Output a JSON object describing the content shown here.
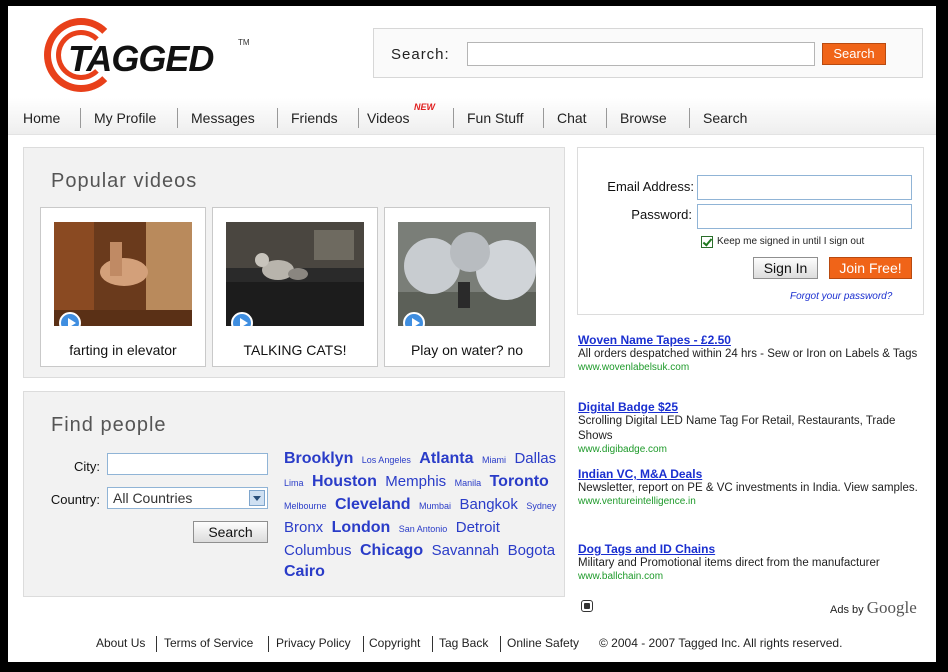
{
  "header": {
    "logo_text": "TAGGED",
    "logo_tm": "TM",
    "search_label": "Search:",
    "search_placeholder": "",
    "search_button": "Search"
  },
  "nav": {
    "items": [
      "Home",
      "My Profile",
      "Messages",
      "Friends",
      "Videos",
      "Fun Stuff",
      "Chat",
      "Browse",
      "Search"
    ],
    "videos_badge": "NEW"
  },
  "popular_videos": {
    "title": "Popular videos",
    "videos": [
      {
        "caption": "farting in elevator"
      },
      {
        "caption": "TALKING CATS!"
      },
      {
        "caption": "Play on water? no"
      }
    ]
  },
  "find_people": {
    "title": "Find people",
    "city_label": "City:",
    "city_value": "",
    "country_label": "Country:",
    "country_value": "All Countries",
    "search_button": "Search",
    "cities": [
      {
        "name": "Brooklyn",
        "size": "l"
      },
      {
        "name": "Los Angeles",
        "size": "s"
      },
      {
        "name": "Atlanta",
        "size": "l"
      },
      {
        "name": "Miami",
        "size": "s"
      },
      {
        "name": "Dallas",
        "size": "m"
      },
      {
        "name": "Lima",
        "size": "s"
      },
      {
        "name": "Houston",
        "size": "l"
      },
      {
        "name": "Memphis",
        "size": "m"
      },
      {
        "name": "Manila",
        "size": "s"
      },
      {
        "name": "Toronto",
        "size": "l"
      },
      {
        "name": "Melbourne",
        "size": "s"
      },
      {
        "name": "Cleveland",
        "size": "l"
      },
      {
        "name": "Mumbai",
        "size": "s"
      },
      {
        "name": "Bangkok",
        "size": "m"
      },
      {
        "name": "Sydney",
        "size": "s"
      },
      {
        "name": "Bronx",
        "size": "m"
      },
      {
        "name": "London",
        "size": "l"
      },
      {
        "name": "San Antonio",
        "size": "s"
      },
      {
        "name": "Detroit",
        "size": "m"
      },
      {
        "name": "Columbus",
        "size": "m"
      },
      {
        "name": "Chicago",
        "size": "l"
      },
      {
        "name": "Savannah",
        "size": "m"
      },
      {
        "name": "Bogota",
        "size": "m"
      },
      {
        "name": "Cairo",
        "size": "l"
      }
    ]
  },
  "login": {
    "email_label": "Email Address:",
    "email_value": "",
    "password_label": "Password:",
    "password_value": "",
    "keep_signed_in": "Keep me signed in until I sign out",
    "sign_in_button": "Sign In",
    "join_button": "Join Free!",
    "forgot_link": "Forgot your password?"
  },
  "ads": {
    "items": [
      {
        "title": "Woven Name Tapes - £2.50",
        "desc": "All orders despatched within 24 hrs - Sew or Iron on Labels & Tags",
        "url": "www.wovenlabelsuk.com"
      },
      {
        "title": "Digital Badge $25",
        "desc": "Scrolling Digital LED Name Tag For Retail, Restaurants, Trade Shows",
        "url": "www.digibadge.com"
      },
      {
        "title": "Indian VC, M&A Deals",
        "desc": "Newsletter, report on PE & VC investments in India. View samples.",
        "url": "www.ventureintelligence.in"
      },
      {
        "title": "Dog Tags and ID Chains",
        "desc": "Military and Promotional items direct from the manufacturer",
        "url": "www.ballchain.com"
      }
    ],
    "ads_by": "Ads by",
    "google": "Google"
  },
  "footer": {
    "links": [
      "About Us",
      "Terms of Service",
      "Privacy Policy",
      "Copyright",
      "Tag Back",
      "Online Safety"
    ],
    "copyright": "© 2004 - 2007 Tagged Inc. All rights reserved."
  },
  "colors": {
    "accent_orange": "#f06418",
    "link_blue": "#1a2fd0",
    "city_blue": "#2a3cc8",
    "url_green": "#1e9a2a",
    "logo_red": "#e8401a"
  }
}
